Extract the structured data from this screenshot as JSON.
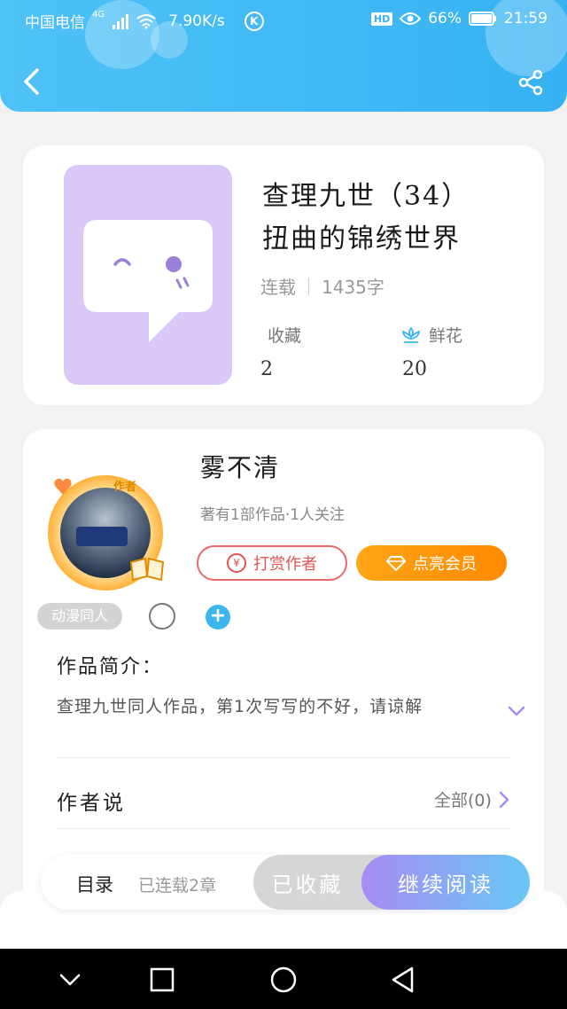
{
  "status_bar": {
    "carrier": "中国电信",
    "network": "4G",
    "speed": "7.90K/s",
    "k_icon": "K",
    "hd": "HD",
    "battery": "66%",
    "time": "21:59"
  },
  "header": {
    "back_icon": "chevron-left-icon",
    "share_icon": "share-icon",
    "color": "#36b2f2"
  },
  "book": {
    "title_line1": "查理九世（34）",
    "title_line2": "扭曲的锦绣世界",
    "status": "连载",
    "word_count": "1435字",
    "favorites_label": "收藏",
    "favorites_value": "2",
    "flowers_label": "鲜花",
    "flowers_value": "20",
    "cover_color": "#d9c8f8"
  },
  "author": {
    "tag": "作者",
    "name": "雾不清",
    "meta": "著有1部作品·1人关注",
    "reward_label": "打赏作者",
    "reward_icon": "¥",
    "vip_label": "点亮会员",
    "category_tag": "动漫同人"
  },
  "intro": {
    "title": "作品简介：",
    "text": "查理九世同人作品，第1次写写的不好，请谅解"
  },
  "author_say": {
    "title": "作者说",
    "all_label": "全部(0)"
  },
  "bottom_bar": {
    "toc_label": "目录",
    "toc_status": "已连载2章",
    "collected_label": "已收藏",
    "read_label": "继续阅读"
  },
  "colors": {
    "accent_blue": "#3cb6ef",
    "accent_orange": "#ff8a00",
    "accent_red": "#e05555",
    "accent_purple": "#a88cf4"
  }
}
